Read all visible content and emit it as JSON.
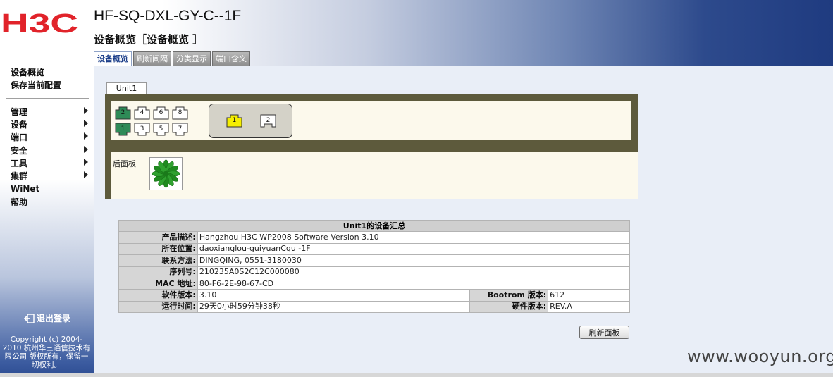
{
  "header": {
    "logo_text": "H3C",
    "device_name": "HF-SQ-DXL-GY-C--1F",
    "page_heading": "设备概览［设备概览 ］",
    "tabs": [
      "设备概览",
      "刷新间隔",
      "分类显示",
      "端口含义"
    ],
    "active_tab": 0,
    "colors": {
      "logo": "#e1232a",
      "banner_end": "#1f3b80"
    }
  },
  "sidebar": {
    "top_links": [
      "设备概览",
      "保存当前配置"
    ],
    "menu": [
      {
        "label": "管理",
        "has_submenu": true
      },
      {
        "label": "设备",
        "has_submenu": true
      },
      {
        "label": "端口",
        "has_submenu": true
      },
      {
        "label": "安全",
        "has_submenu": true
      },
      {
        "label": "工具",
        "has_submenu": true
      },
      {
        "label": "集群",
        "has_submenu": true
      },
      {
        "label": "WiNet",
        "has_submenu": false
      },
      {
        "label": "帮助",
        "has_submenu": false
      }
    ],
    "logout_label": "退出登录",
    "copyright": "Copyright (c) 2004-2010 杭州华三通信技术有限公司 版权所有，保留一切权利。"
  },
  "panel": {
    "unit_tab": "Unit1",
    "ports_top": [
      "2",
      "4",
      "6",
      "8"
    ],
    "ports_bottom": [
      "1",
      "3",
      "5",
      "7"
    ],
    "active_ports": [
      "1",
      "2"
    ],
    "sfp_ports": [
      "1",
      "2"
    ],
    "sfp_active": [
      "1"
    ],
    "rear_label": "后面板",
    "fan_icon": "fan-icon",
    "colors": {
      "port_active": "#2e8b57",
      "sfp_active": "#f5ee00",
      "frame": "#5d5a3c",
      "panel_bg": "#fcf9ec"
    }
  },
  "summary": {
    "title": "Unit1的设备汇总",
    "rows": [
      {
        "label": "产品描述:",
        "value": "Hangzhou H3C WP2008 Software Version 3.10"
      },
      {
        "label": "所在位置:",
        "value": "daoxianglou-guiyuanCqu -1F"
      },
      {
        "label": "联系方法:",
        "value": "DINGQING, 0551-3180030"
      },
      {
        "label": "序列号:",
        "value": "210235A0S2C12C000080"
      },
      {
        "label": "MAC 地址:",
        "value": "80-F6-2E-98-67-CD"
      }
    ],
    "split_rows": [
      {
        "label": "软件版本:",
        "value": "3.10",
        "label2": "Bootrom 版本:",
        "value2": "612"
      },
      {
        "label": "运行时间:",
        "value": "29天0小时59分钟38秒",
        "label2": "硬件版本:",
        "value2": "REV.A"
      }
    ]
  },
  "refresh_button": "刷新面板",
  "watermark": "www.wooyun.org"
}
